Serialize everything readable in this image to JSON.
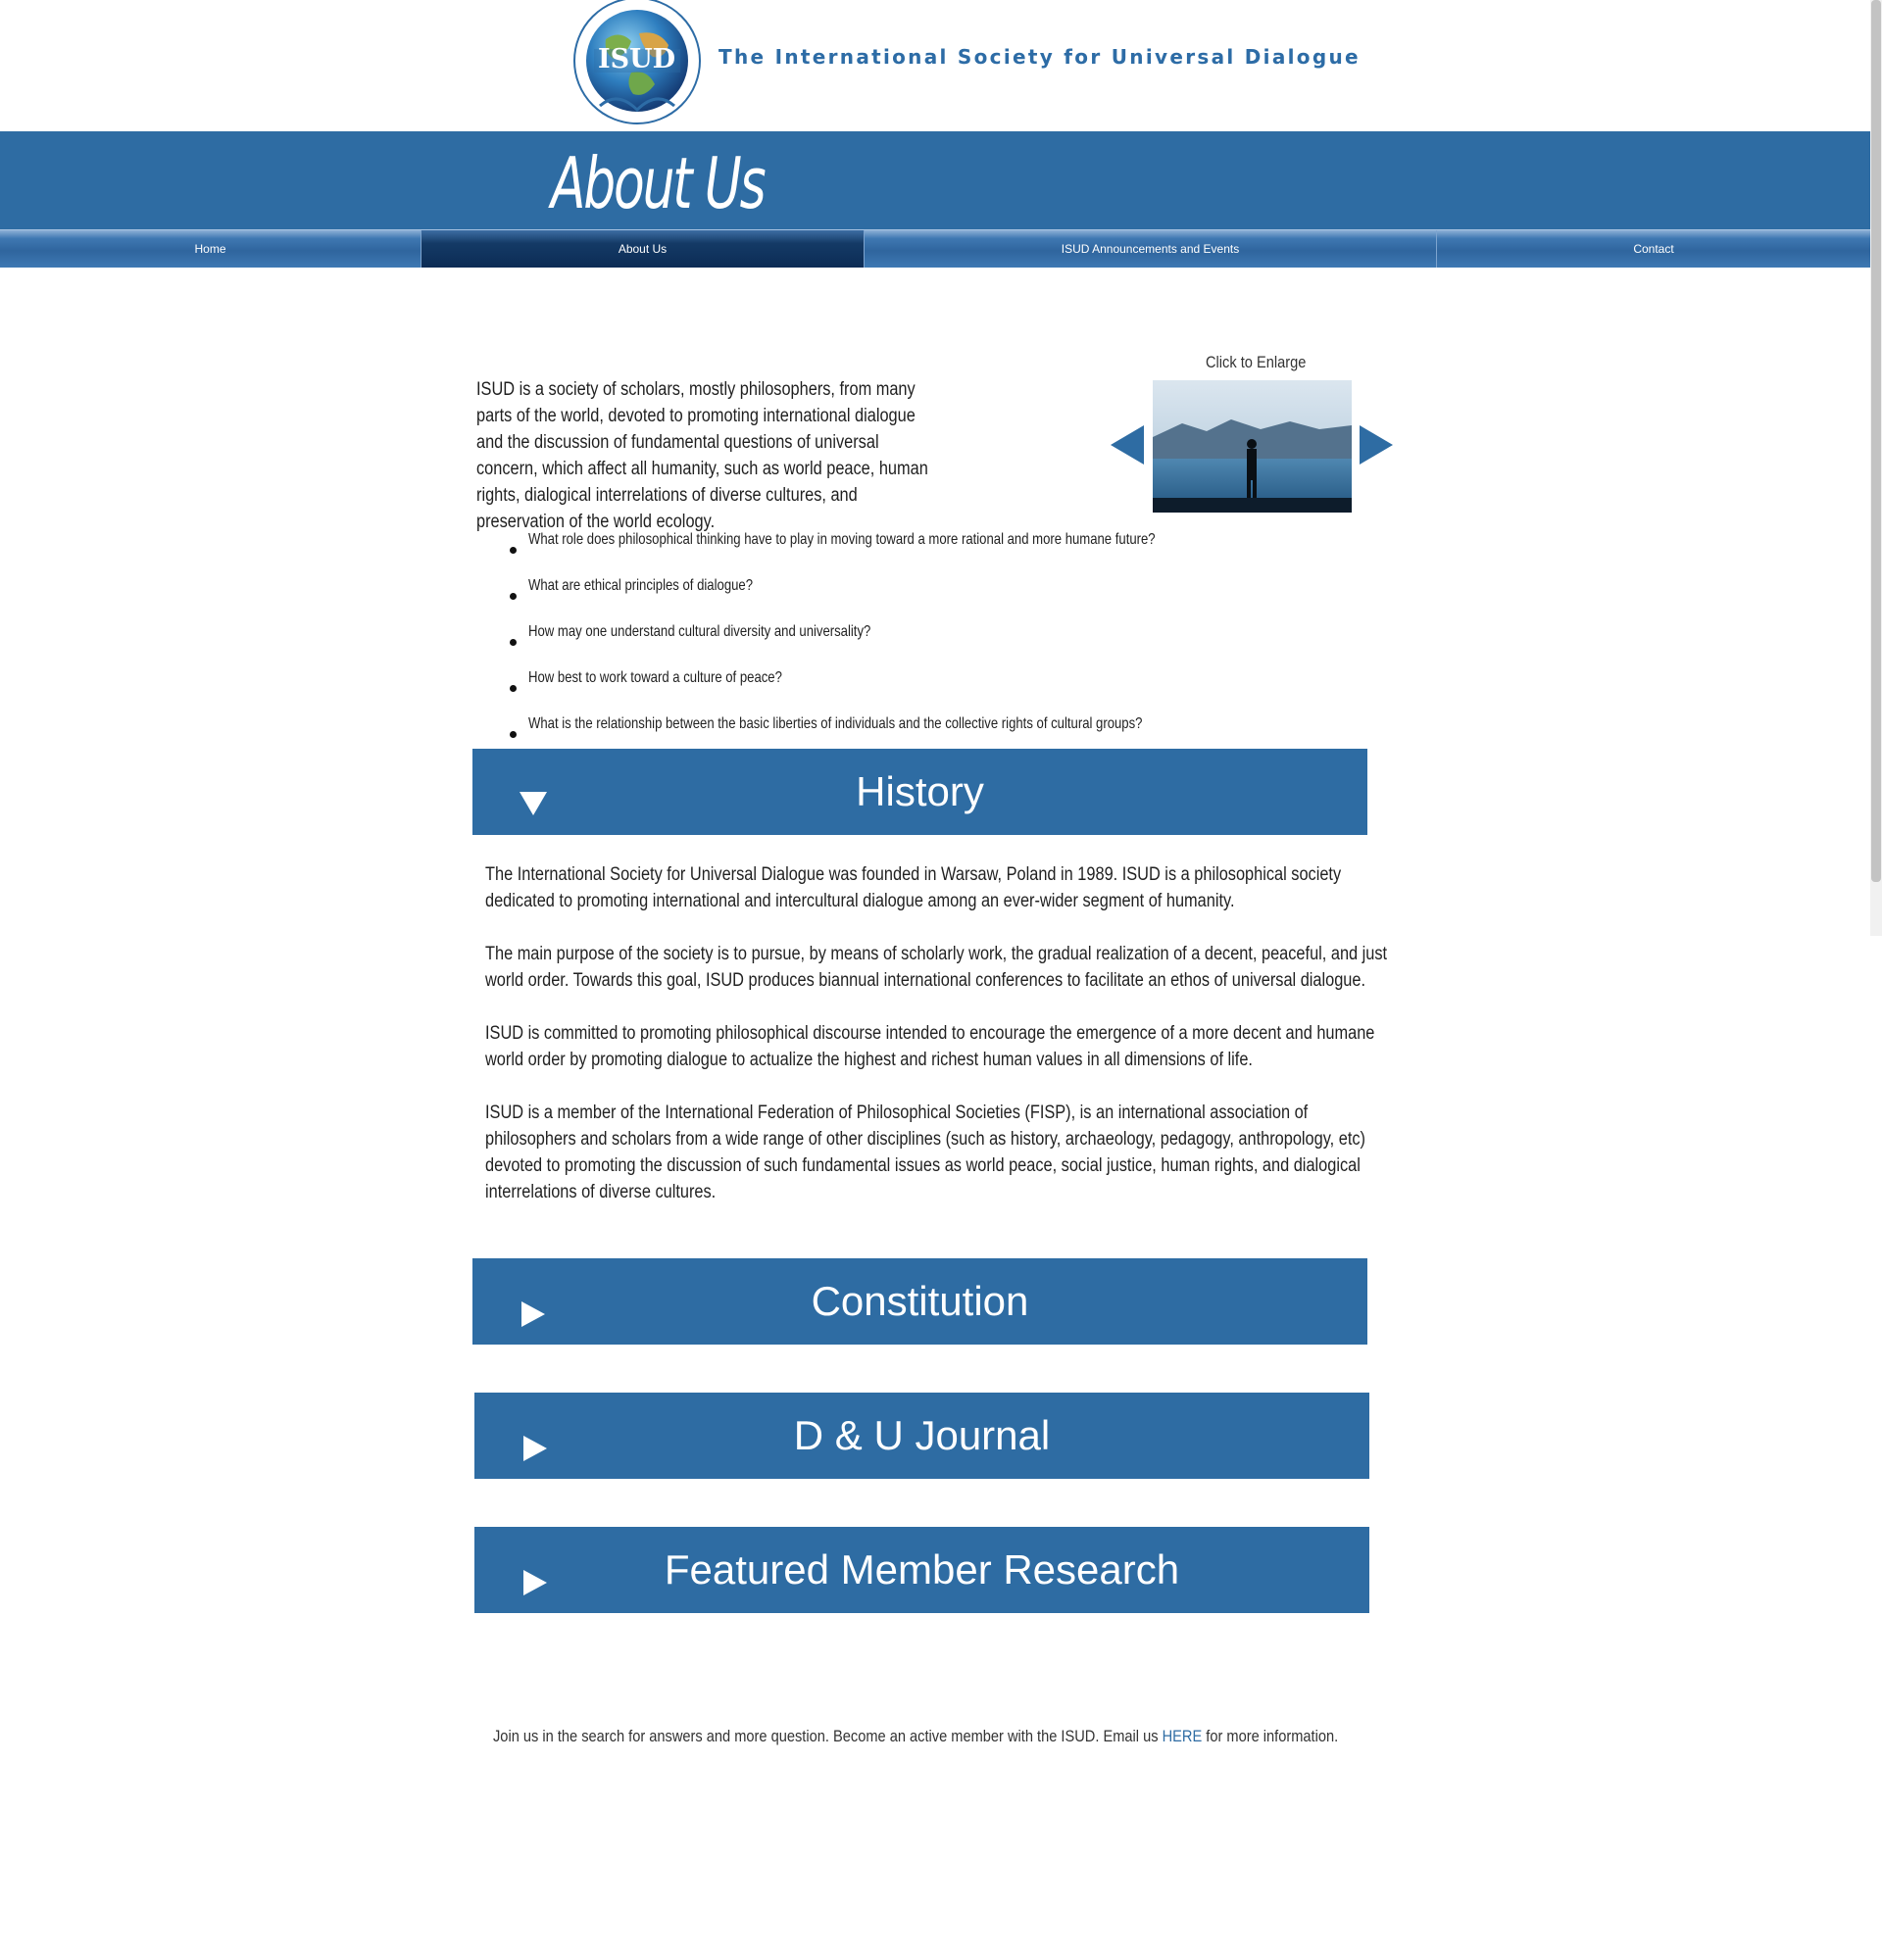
{
  "header": {
    "logo_text": "ISUD",
    "site_title": "The International Society for Universal Dialogue",
    "banner_title": "About Us"
  },
  "nav": {
    "items": [
      {
        "label": "Home",
        "active": false
      },
      {
        "label": "About Us",
        "active": true
      },
      {
        "label": "ISUD Announcements and Events",
        "active": false
      },
      {
        "label": "Contact",
        "active": false
      }
    ]
  },
  "intro": {
    "text": "ISUD is a society of scholars, mostly philosophers, from many parts of the world, devoted to promoting international dialogue and the discussion of fundamental questions of universal concern, which affect all humanity, such as world peace, human rights, dialogical interrelations of diverse cultures, and preservation of the world ecology.",
    "enlarge_label": "Click to Enlarge",
    "questions": [
      "What role does philosophical thinking have to play in moving toward a more rational and more humane future?",
      "What are ethical principles of dialogue?",
      "How may one understand cultural diversity and universality?",
      "How best to work toward a culture of peace?",
      "What is the relationship between the basic liberties of individuals and the collective rights of cultural groups?"
    ]
  },
  "accordion": {
    "history": {
      "title": "History",
      "expanded": true,
      "paragraphs": [
        "The International Society for Universal Dialogue was founded in Warsaw, Poland in 1989. ISUD is a philosophical society dedicated to promoting international and intercultural dialogue among an ever-wider segment of humanity.",
        "The main purpose of the society is to pursue, by means of scholarly work, the gradual realization of a decent, peaceful, and just world order. Towards this goal, ISUD produces biannual international conferences to facilitate an ethos of universal dialogue.",
        "ISUD is committed to promoting philosophical discourse intended to encourage the emergence of a more decent and humane world order by promoting dialogue to actualize the highest and richest human values in all dimensions of life.",
        "ISUD is a member of the International Federation of Philosophical Societies (FISP), is an international association of philosophers and scholars from a wide range of other disciplines (such as history, archaeology, pedagogy, anthropology, etc) devoted to promoting the discussion of such fundamental issues as world peace, social justice, human rights, and dialogical interrelations of diverse cultures."
      ]
    },
    "constitution": {
      "title": "Constitution",
      "expanded": false
    },
    "journal": {
      "title": "D & U Journal",
      "expanded": false
    },
    "research": {
      "title": "Featured Member Research",
      "expanded": false
    }
  },
  "footer": {
    "before_link": "Join us in the search for answers and more question. Become an active member with the ISUD. Email us ",
    "link_text": "HERE",
    "after_link": " for more information."
  },
  "colors": {
    "brand_blue": "#2e6ca3",
    "nav_active": "#0c2c55"
  }
}
